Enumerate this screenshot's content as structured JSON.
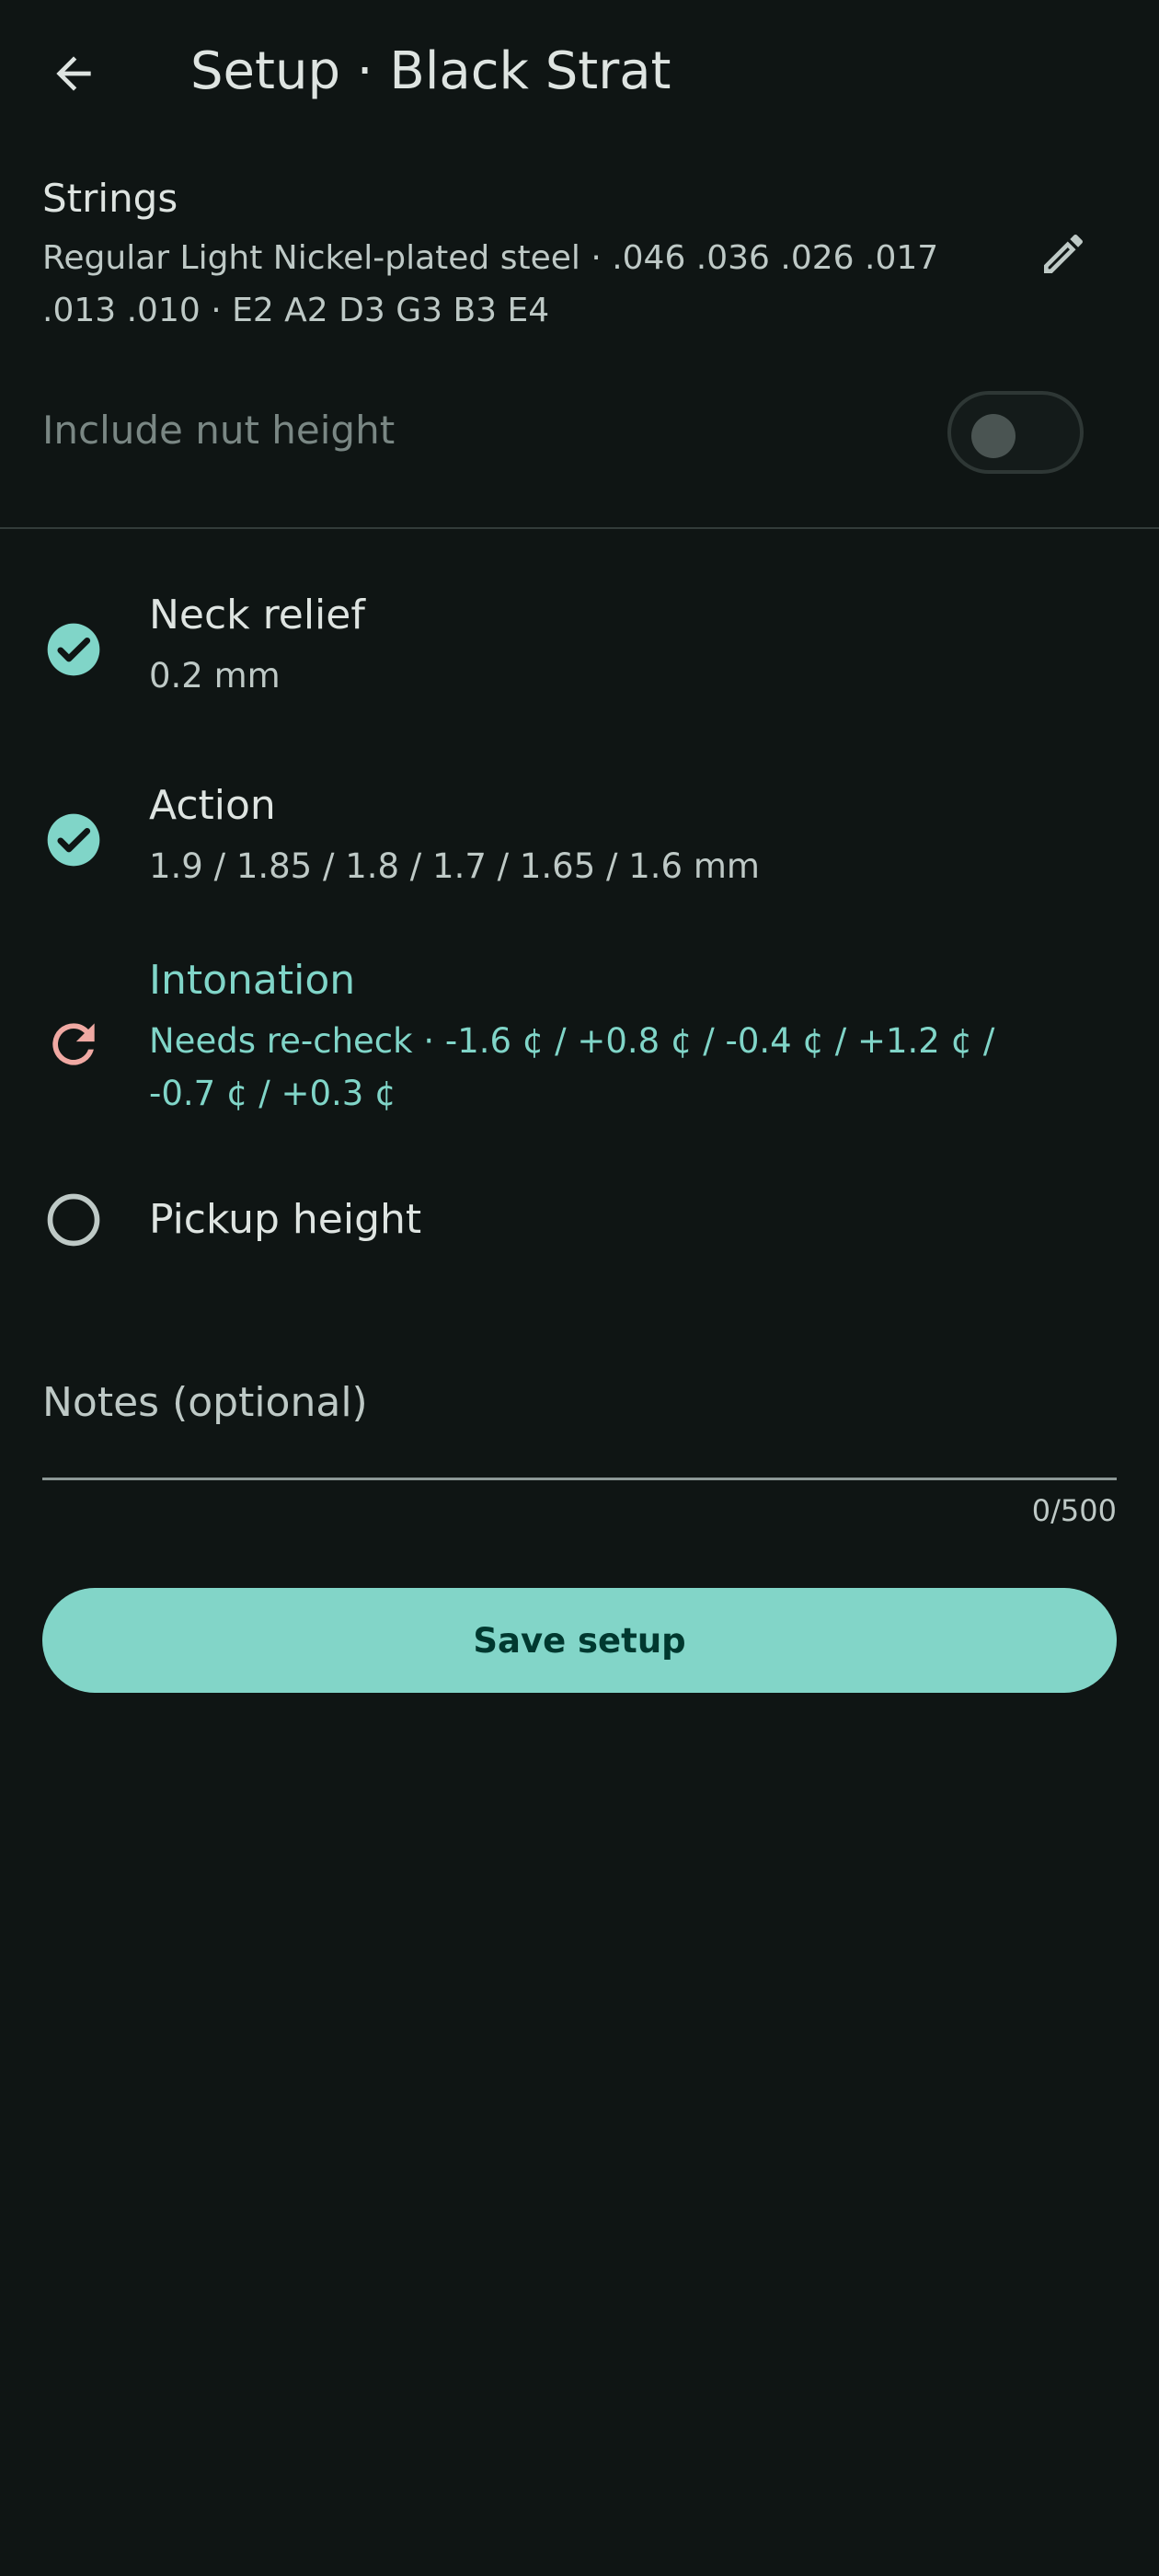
{
  "app_bar": {
    "title": "Setup · Black Strat",
    "back_icon": "arrow-back-icon"
  },
  "strings": {
    "heading": "Strings",
    "description": "Regular Light Nickel-plated steel · .046 .036 .026 .017 .013 .010 · E2 A2 D3 G3 B3 E4",
    "edit_icon": "pencil-icon"
  },
  "nut_height": {
    "label": "Include nut height",
    "enabled": false
  },
  "checklist": [
    {
      "title": "Neck relief",
      "subtitle": "0.2 mm",
      "status": "done",
      "icon": "check-circle-icon"
    },
    {
      "title": "Action",
      "subtitle": "1.9 / 1.85 / 1.8 / 1.7 / 1.65 / 1.6 mm",
      "status": "done",
      "icon": "check-circle-icon"
    },
    {
      "title": "Intonation",
      "subtitle": "Needs re-check · -1.6 ¢ / +0.8 ¢ / -0.4 ¢ / +1.2 ¢ / -0.7 ¢ / +0.3 ¢",
      "status": "recheck",
      "icon": "refresh-icon"
    },
    {
      "title": "Pickup height",
      "subtitle": "",
      "status": "pending",
      "icon": "empty-circle-icon"
    }
  ],
  "notes": {
    "placeholder": "Notes (optional)",
    "counter": "0/500"
  },
  "save_button": {
    "label": "Save setup"
  },
  "colors": {
    "background": "#0f1514",
    "accent": "#80d5c8",
    "recheck": "#f0a9a3",
    "button_text": "#00382f"
  }
}
